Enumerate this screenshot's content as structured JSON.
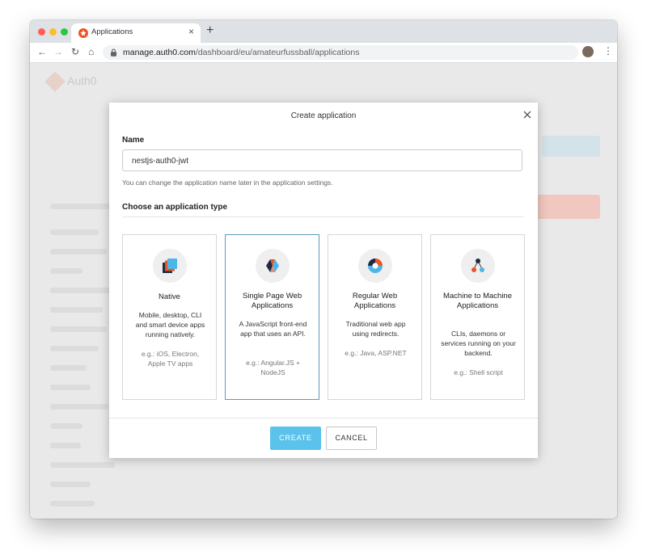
{
  "browser": {
    "tab_title": "Applications",
    "tab_close": "×",
    "new_tab": "+",
    "url_host": "manage.auth0.com",
    "url_path": "/dashboard/eu/amateurfussball/applications",
    "back": "←",
    "forward": "→",
    "reload": "↻",
    "home": "⌂",
    "star": "☆",
    "menu": "⋮"
  },
  "background": {
    "brand": "Auth0"
  },
  "modal": {
    "title": "Create application",
    "name_label": "Name",
    "name_value": "nestjs-auth0-jwt",
    "name_hint": "You can change the application name later in the application settings.",
    "type_label": "Choose an application type",
    "cards": [
      {
        "name": "Native",
        "description": "Mobile, desktop, CLI and smart device apps running natively.",
        "example": "e.g.: iOS, Electron, Apple TV apps",
        "selected": false
      },
      {
        "name": "Single Page Web Applications",
        "description": "A JavaScript front-end app that uses an API.",
        "example": "e.g.: Angular.JS + NodeJS",
        "selected": true
      },
      {
        "name": "Regular Web Applications",
        "description": "Traditional web app using redirects.",
        "example": "e.g.: Java, ASP.NET",
        "selected": false
      },
      {
        "name": "Machine to Machine Applications",
        "description": "CLIs, daemons or services running on your backend.",
        "example": "e.g.: Shell script",
        "selected": false
      }
    ],
    "create_label": "CREATE",
    "cancel_label": "CANCEL"
  },
  "colors": {
    "accent": "#5bc2eb",
    "selected_border": "#5b9bb7",
    "brand": "#eb5424"
  }
}
